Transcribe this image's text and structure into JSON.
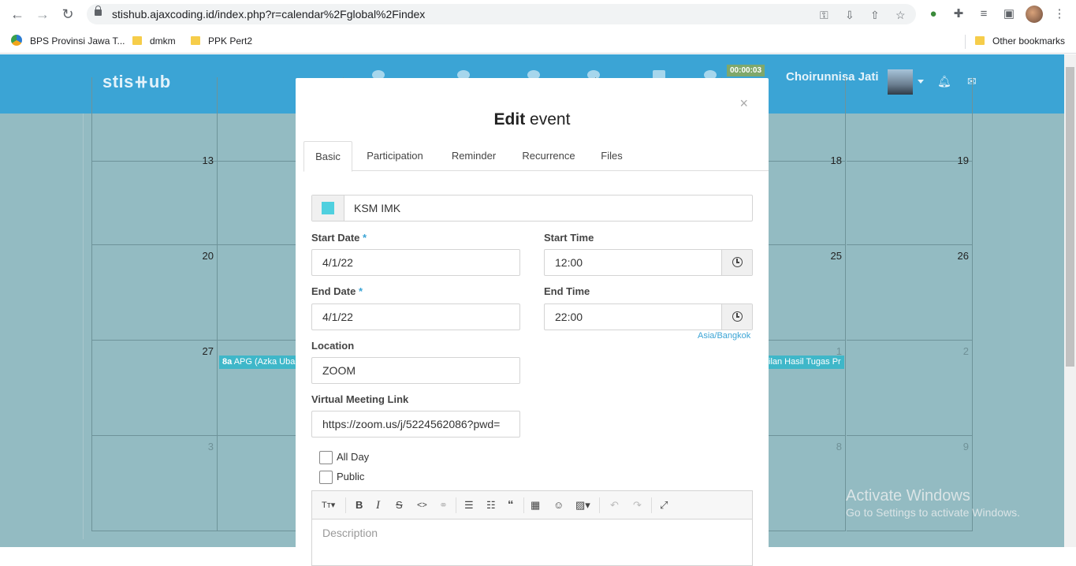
{
  "browser": {
    "url": "stishub.ajaxcoding.id/index.php?r=calendar%2Fglobal%2Findex",
    "bookmarks": [
      "BPS Provinsi Jawa T...",
      "dmkm",
      "PPK Pert2"
    ],
    "other_bookmarks": "Other bookmarks"
  },
  "header": {
    "logo": "stis⧺ub",
    "timer": "00:00:03",
    "username": "Choirunnisa Jati"
  },
  "calendar": {
    "rows": [
      [
        "13",
        "",
        "",
        "",
        "",
        "18",
        "19"
      ],
      [
        "20",
        "",
        "",
        "",
        "",
        "25",
        "26"
      ],
      [
        "27",
        "",
        "",
        "",
        "",
        "1",
        "2"
      ],
      [
        "3",
        "",
        "",
        "",
        "",
        "8",
        "9"
      ]
    ],
    "events": [
      {
        "time": "8a",
        "title": "APG (Azka Ubai"
      },
      {
        "time": "",
        "title": "ilan Hasil Tugas Pr"
      }
    ]
  },
  "modal": {
    "close": "×",
    "title_bold": "Edit",
    "title_rest": " event",
    "tabs": [
      "Basic",
      "Participation",
      "Reminder",
      "Recurrence",
      "Files"
    ],
    "color": "#4fd0df",
    "event_title": "KSM IMK",
    "start_date_label": "Start Date",
    "start_date": "4/1/22",
    "start_time_label": "Start Time",
    "start_time": "12:00",
    "end_date_label": "End Date",
    "end_date": "4/1/22",
    "end_time_label": "End Time",
    "end_time": "22:00",
    "timezone": "Asia/Bangkok",
    "location_label": "Location",
    "location": "ZOOM",
    "meeting_label": "Virtual Meeting Link",
    "meeting_link": "https://zoom.us/j/5224562086?pwd=",
    "all_day": "All Day",
    "public": "Public",
    "description_placeholder": "Description",
    "required_mark": "*"
  },
  "watermark": {
    "title": "Activate Windows",
    "subtitle": "Go to Settings to activate Windows."
  }
}
